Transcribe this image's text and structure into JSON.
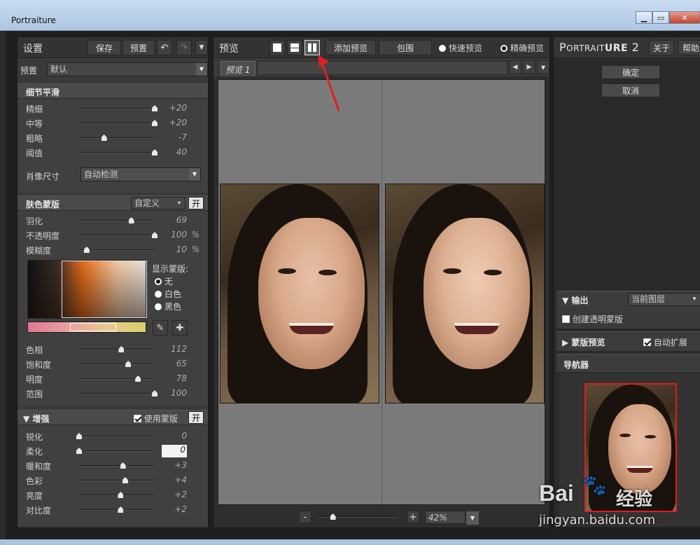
{
  "window": {
    "title": "Portraiture"
  },
  "settings": {
    "title": "设置",
    "save": "保存",
    "preset_btn": "预置",
    "preset_label": "预置",
    "preset_value": "默认"
  },
  "detail": {
    "title": "细节平滑",
    "rows": [
      {
        "label": "精细",
        "value": "+20",
        "level": 1.0
      },
      {
        "label": "中等",
        "value": "+20",
        "level": 1.0
      },
      {
        "label": "粗略",
        "value": "-7",
        "level": 0.33
      },
      {
        "label": "阈值",
        "value": "40",
        "level": 1.0
      }
    ],
    "size_label": "肖像尺寸",
    "size_value": "自动检测"
  },
  "skin": {
    "title": "肤色蒙版",
    "mode": "自定义",
    "toggle": "开",
    "rows": [
      {
        "label": "羽化",
        "value": "69",
        "unit": "",
        "level": 0.69
      },
      {
        "label": "不透明度",
        "value": "100",
        "unit": "%",
        "level": 1.0
      },
      {
        "label": "模糊度",
        "value": "10",
        "unit": "%",
        "level": 0.1
      }
    ],
    "show_mask": "显示蒙版:",
    "options": [
      "无",
      "白色",
      "黑色"
    ],
    "rows2": [
      {
        "label": "色相",
        "value": "112",
        "level": 0.56
      },
      {
        "label": "饱和度",
        "value": "65",
        "level": 0.65
      },
      {
        "label": "明度",
        "value": "78",
        "level": 0.78
      },
      {
        "label": "范围",
        "value": "100",
        "level": 1.0
      }
    ]
  },
  "enhance": {
    "title": "增强",
    "use_mask": "使用蒙版",
    "toggle": "开",
    "rows": [
      {
        "label": "锐化",
        "value": "0",
        "level": 0.0
      },
      {
        "label": "柔化",
        "value": "0",
        "level": 0.0
      },
      {
        "label": "暖和度",
        "value": "+3",
        "level": 0.58
      },
      {
        "label": "色彩",
        "value": "+4",
        "level": 0.61
      },
      {
        "label": "亮度",
        "value": "+2",
        "level": 0.55
      },
      {
        "label": "对比度",
        "value": "+2",
        "level": 0.55
      }
    ]
  },
  "preview": {
    "title": "预览",
    "add_preview": "添加预览",
    "bracket": "包围",
    "fast": "快速预览",
    "accurate": "精确预览",
    "tab": "预览 1",
    "zoom": "42%",
    "zoom_level": 0.18,
    "minus": "-",
    "plus": "+"
  },
  "right": {
    "brand_prefix": "P",
    "brand_small": "ORTRAIT",
    "brand_bold": "URE",
    "brand_num": "2",
    "about": "关于",
    "help": "帮助",
    "ok": "确定",
    "cancel": "取消",
    "output_label": "输出",
    "output_value": "当前图层",
    "create_mask": "创建透明蒙版",
    "mask_preview": "蒙版预览",
    "auto_expand": "自动扩展",
    "navigator": "导航器"
  },
  "watermark": {
    "brand": "Bai",
    "brand2": "经验",
    "url": "jingyan.baidu.com"
  }
}
